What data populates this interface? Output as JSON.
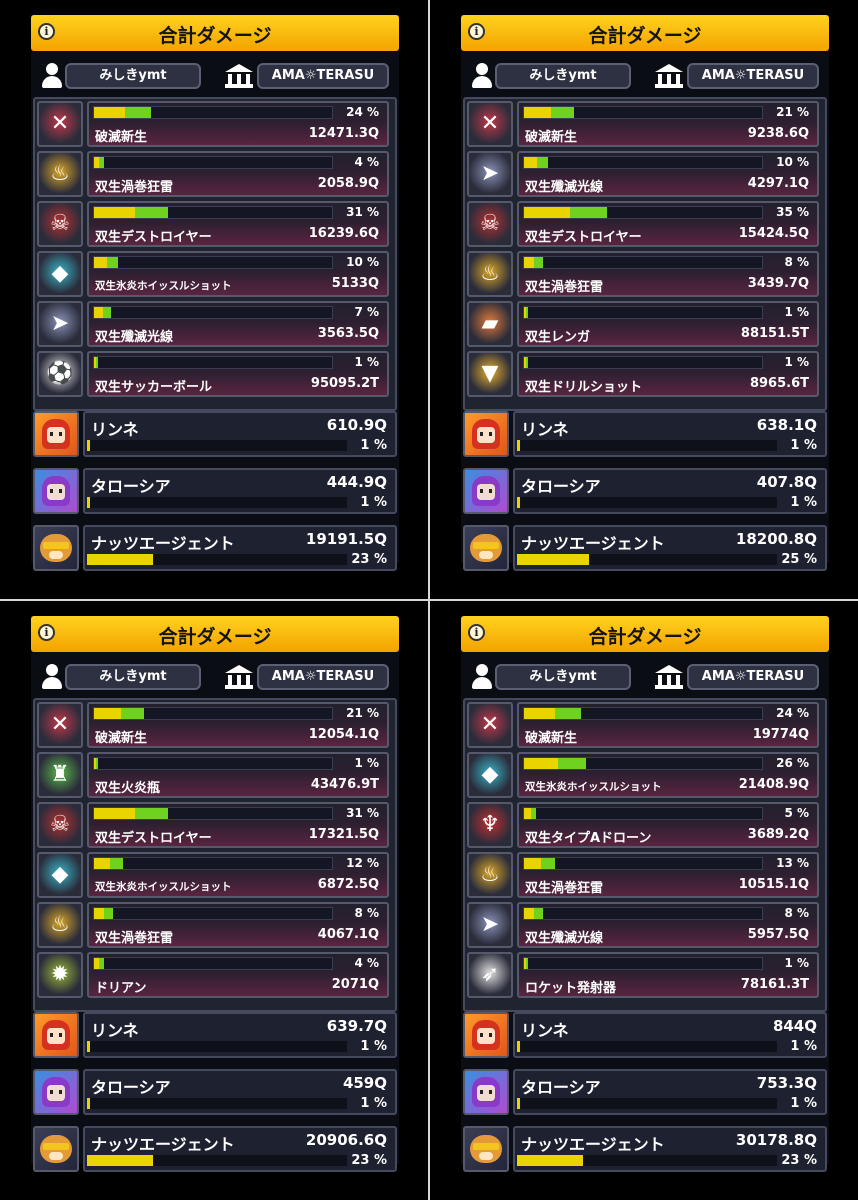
{
  "common": {
    "title": "合計ダメージ",
    "info_icon": "i",
    "player_name": "みしきymt",
    "guild_name": "AMA☼TERASU"
  },
  "panels": [
    {
      "items": [
        {
          "icon": "crossed-blades-emblem",
          "name": "破滅新生",
          "percent": "24 %",
          "damage": "12471.3Q",
          "fill": 24,
          "color": "#c0384a"
        },
        {
          "icon": "tesla-coil",
          "name": "双生渦巻狂雷",
          "percent": "4 %",
          "damage": "2058.9Q",
          "fill": 4,
          "color": "#d9a62a"
        },
        {
          "icon": "destroyer-robot",
          "name": "双生デストロイヤー",
          "percent": "31 %",
          "damage": "16239.6Q",
          "fill": 31,
          "color": "#b33030"
        },
        {
          "icon": "ice-fire-whistle-blade",
          "name": "双生氷炎ホイッスルショット",
          "percent": "10 %",
          "damage": "5133Q",
          "fill": 10,
          "color": "#3ab4c8"
        },
        {
          "icon": "laser-drone",
          "name": "双生殲滅光線",
          "percent": "7 %",
          "damage": "3563.5Q",
          "fill": 7,
          "color": "#8a93b8"
        },
        {
          "icon": "soccer-ball",
          "name": "双生サッカーボール",
          "percent": "1 %",
          "damage": "95095.2T",
          "fill": 1,
          "color": "#e8e8e8"
        }
      ],
      "characters": [
        {
          "icon": "rinne-portrait",
          "name": "リンネ",
          "damage": "610.9Q",
          "percent": "1 %",
          "fill": 1
        },
        {
          "icon": "tarosia-portrait",
          "name": "タローシア",
          "damage": "444.9Q",
          "percent": "1 %",
          "fill": 1
        },
        {
          "icon": "nuts-agent-portrait",
          "name": "ナッツエージェント",
          "damage": "19191.5Q",
          "percent": "23 %",
          "fill": 23
        }
      ]
    },
    {
      "items": [
        {
          "icon": "crossed-blades-emblem",
          "name": "破滅新生",
          "percent": "21 %",
          "damage": "9238.6Q",
          "fill": 21,
          "color": "#c0384a"
        },
        {
          "icon": "laser-drone",
          "name": "双生殲滅光線",
          "percent": "10 %",
          "damage": "4297.1Q",
          "fill": 10,
          "color": "#8a93b8"
        },
        {
          "icon": "destroyer-robot",
          "name": "双生デストロイヤー",
          "percent": "35 %",
          "damage": "15424.5Q",
          "fill": 35,
          "color": "#b33030"
        },
        {
          "icon": "tesla-coil",
          "name": "双生渦巻狂雷",
          "percent": "8 %",
          "damage": "3439.7Q",
          "fill": 8,
          "color": "#d9a62a"
        },
        {
          "icon": "brick",
          "name": "双生レンガ",
          "percent": "1 %",
          "damage": "88151.5T",
          "fill": 1,
          "color": "#e07a3a"
        },
        {
          "icon": "drill-shot",
          "name": "双生ドリルショット",
          "percent": "1 %",
          "damage": "8965.6T",
          "fill": 1,
          "color": "#e8b030"
        }
      ],
      "characters": [
        {
          "icon": "rinne-portrait",
          "name": "リンネ",
          "damage": "638.1Q",
          "percent": "1 %",
          "fill": 1
        },
        {
          "icon": "tarosia-portrait",
          "name": "タローシア",
          "damage": "407.8Q",
          "percent": "1 %",
          "fill": 1
        },
        {
          "icon": "nuts-agent-portrait",
          "name": "ナッツエージェント",
          "damage": "18200.8Q",
          "percent": "25 %",
          "fill": 25
        }
      ]
    },
    {
      "items": [
        {
          "icon": "crossed-blades-emblem",
          "name": "破滅新生",
          "percent": "21 %",
          "damage": "12054.1Q",
          "fill": 21,
          "color": "#c0384a"
        },
        {
          "icon": "molotov-bottle",
          "name": "双生火炎瓶",
          "percent": "1 %",
          "damage": "43476.9T",
          "fill": 1,
          "color": "#5ab84a"
        },
        {
          "icon": "destroyer-robot",
          "name": "双生デストロイヤー",
          "percent": "31 %",
          "damage": "17321.5Q",
          "fill": 31,
          "color": "#b33030"
        },
        {
          "icon": "ice-fire-whistle-blade",
          "name": "双生氷炎ホイッスルショット",
          "percent": "12 %",
          "damage": "6872.5Q",
          "fill": 12,
          "color": "#3ab4c8"
        },
        {
          "icon": "tesla-coil",
          "name": "双生渦巻狂雷",
          "percent": "8 %",
          "damage": "4067.1Q",
          "fill": 8,
          "color": "#d9a62a"
        },
        {
          "icon": "durian",
          "name": "ドリアン",
          "percent": "4 %",
          "damage": "2071Q",
          "fill": 4,
          "color": "#9ab83a"
        }
      ],
      "characters": [
        {
          "icon": "rinne-portrait",
          "name": "リンネ",
          "damage": "639.7Q",
          "percent": "1 %",
          "fill": 1
        },
        {
          "icon": "tarosia-portrait",
          "name": "タローシア",
          "damage": "459Q",
          "percent": "1 %",
          "fill": 1
        },
        {
          "icon": "nuts-agent-portrait",
          "name": "ナッツエージェント",
          "damage": "20906.6Q",
          "percent": "23 %",
          "fill": 23
        }
      ]
    },
    {
      "items": [
        {
          "icon": "crossed-blades-emblem",
          "name": "破滅新生",
          "percent": "24 %",
          "damage": "19774Q",
          "fill": 24,
          "color": "#c0384a"
        },
        {
          "icon": "ice-fire-whistle-blade",
          "name": "双生氷炎ホイッスルショット",
          "percent": "26 %",
          "damage": "21408.9Q",
          "fill": 26,
          "color": "#3ab4c8"
        },
        {
          "icon": "type-a-drone",
          "name": "双生タイプAドローン",
          "percent": "5 %",
          "damage": "3689.2Q",
          "fill": 5,
          "color": "#c03030"
        },
        {
          "icon": "tesla-coil",
          "name": "双生渦巻狂雷",
          "percent": "13 %",
          "damage": "10515.1Q",
          "fill": 13,
          "color": "#d9a62a"
        },
        {
          "icon": "laser-drone",
          "name": "双生殲滅光線",
          "percent": "8 %",
          "damage": "5957.5Q",
          "fill": 8,
          "color": "#8a93b8"
        },
        {
          "icon": "rocket-launcher",
          "name": "ロケット発射器",
          "percent": "1 %",
          "damage": "78161.3T",
          "fill": 1,
          "color": "#e0e0e0"
        }
      ],
      "characters": [
        {
          "icon": "rinne-portrait",
          "name": "リンネ",
          "damage": "844Q",
          "percent": "1 %",
          "fill": 1
        },
        {
          "icon": "tarosia-portrait",
          "name": "タローシア",
          "damage": "753.3Q",
          "percent": "1 %",
          "fill": 1
        },
        {
          "icon": "nuts-agent-portrait",
          "name": "ナッツエージェント",
          "damage": "30178.8Q",
          "percent": "23 %",
          "fill": 23
        }
      ]
    }
  ]
}
